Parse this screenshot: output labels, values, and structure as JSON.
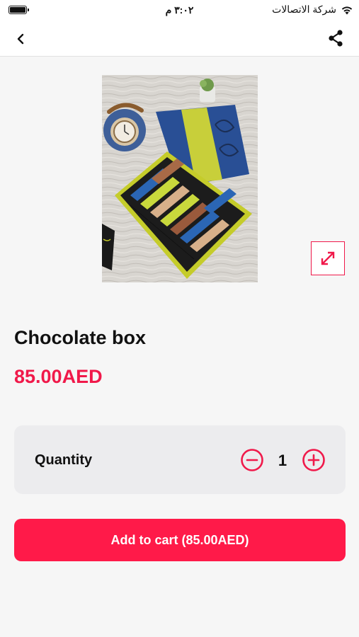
{
  "status_bar": {
    "carrier": "شركة الاتصالات",
    "time": "٣:٠٢ م"
  },
  "nav": {
    "back_icon": "chevron-left-icon",
    "share_icon": "share-icon"
  },
  "product": {
    "image_alt": "Chocolate box photo",
    "expand_icon": "expand-arrows-icon",
    "title": "Chocolate box",
    "price": "85.00AED"
  },
  "quantity": {
    "label": "Quantity",
    "value": "1",
    "minus_icon": "minus-circle-icon",
    "plus_icon": "plus-circle-icon"
  },
  "cart": {
    "button_label": "Add to cart (85.00AED)"
  },
  "colors": {
    "accent": "#f0194a",
    "button": "#ff1a49",
    "background": "#f6f6f6",
    "card": "#ececee"
  }
}
